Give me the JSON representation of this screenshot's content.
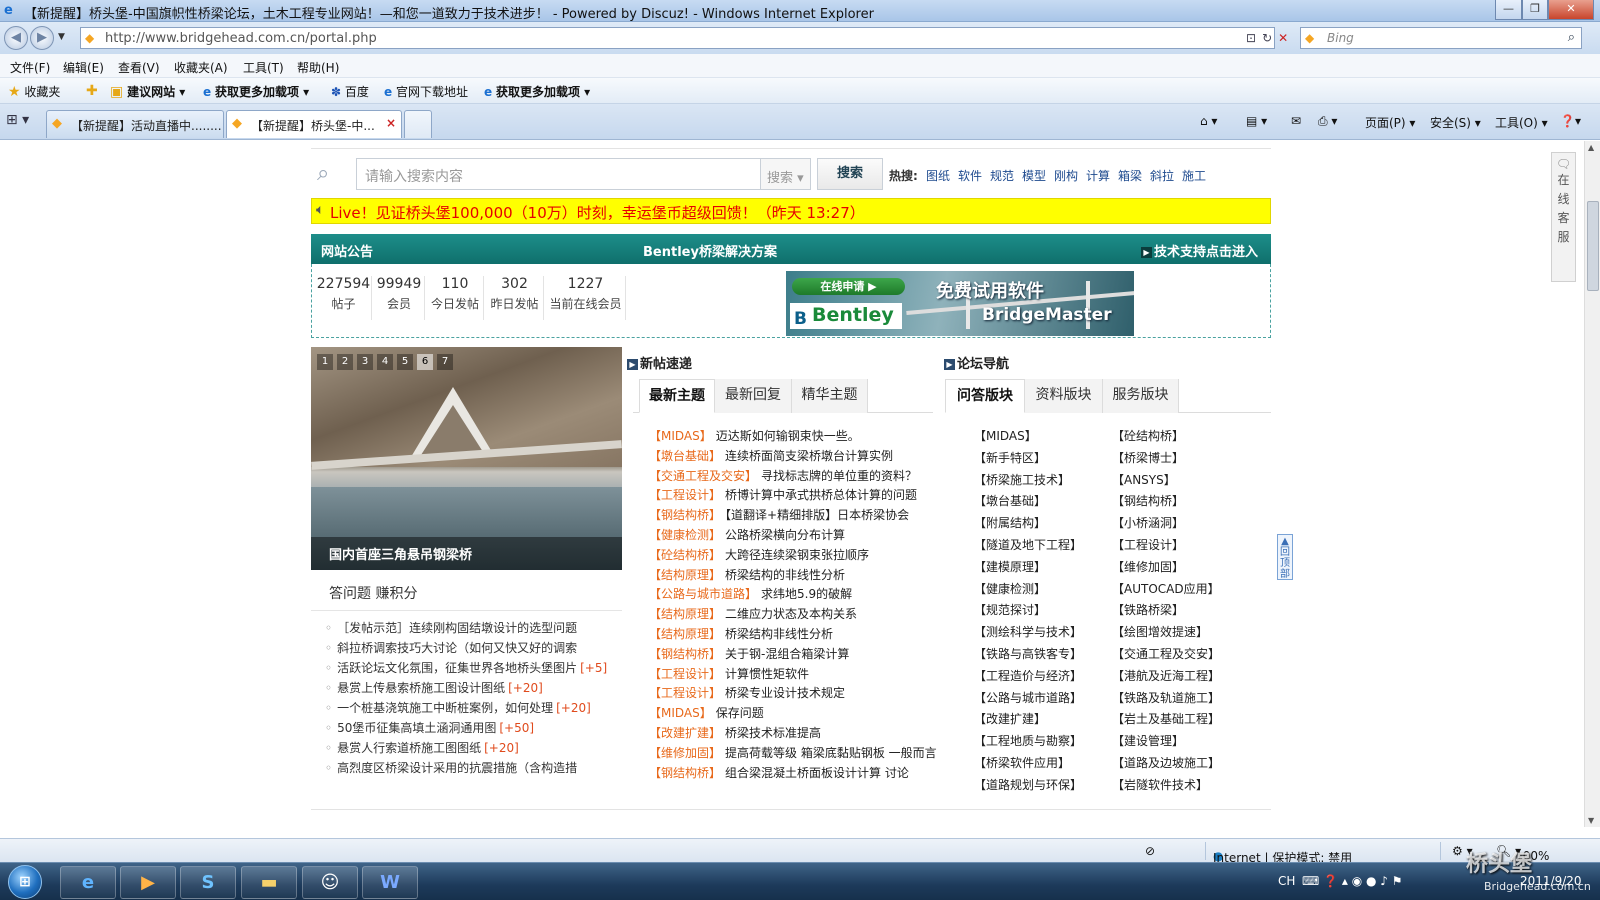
{
  "window": {
    "title": "【新提醒】桥头堡-中国旗帜性桥梁论坛，土木工程专业网站！—和您一道致力于技术进步！ - Powered by Discuz! - Windows Internet Explorer"
  },
  "address": {
    "url": "http://www.bridgehead.com.cn/portal.php",
    "search_placeholder": "Bing"
  },
  "menu": [
    "文件(F)",
    "编辑(E)",
    "查看(V)",
    "收藏夹(A)",
    "工具(T)",
    "帮助(H)"
  ],
  "favorites": {
    "label": "收藏夹",
    "items": [
      "建议网站 ▾",
      "获取更多加载项 ▾",
      "百度",
      "官网下载地址",
      "获取更多加载项 ▾"
    ]
  },
  "tabs": [
    {
      "label": "【新提醒】活动直播中........",
      "active": false
    },
    {
      "label": "【新提醒】桥头堡-中...",
      "active": true
    }
  ],
  "commandbar": [
    "页面(P) ▾",
    "安全(S) ▾",
    "工具(O) ▾"
  ],
  "site": {
    "search_placeholder": "请输入搜索内容",
    "search_scope": "搜索 ▾",
    "search_button": "搜索",
    "hot_label": "热搜:",
    "hot_terms": [
      "图纸",
      "软件",
      "规范",
      "模型",
      "刚构",
      "计算",
      "箱梁",
      "斜拉",
      "施工"
    ],
    "notice": "Live！见证桥头堡100,000（10万）时刻，幸运堡币超级回馈！（昨天 13:27）",
    "announce_left": "网站公告",
    "announce_center": "Bentley桥梁解决方案",
    "announce_right": "技术支持点击进入",
    "stats": [
      {
        "value": "227594",
        "label": "帖子"
      },
      {
        "value": "99949",
        "label": "会员"
      },
      {
        "value": "110",
        "label": "今日发帖"
      },
      {
        "value": "302",
        "label": "昨日发帖"
      },
      {
        "value": "1227",
        "label": "当前在线会员"
      }
    ],
    "banner": {
      "apply": "在线申请 ▶",
      "trial": "免费试用软件",
      "logo": "Bentley",
      "product": "BridgeMaster"
    },
    "slider": {
      "pages": [
        "1",
        "2",
        "3",
        "4",
        "5",
        "6",
        "7"
      ],
      "active_page": "6",
      "caption": "国内首座三角悬吊钢梁桥"
    },
    "qa": {
      "title": "答问题 赚积分",
      "items": [
        {
          "text": "［发帖示范］连续刚构固结墩设计的选型问题",
          "points": ""
        },
        {
          "text": "斜拉桥调索技巧大讨论（如何又快又好的调索",
          "points": ""
        },
        {
          "text": "活跃论坛文化氛围，征集世界各地桥头堡图片",
          "points": "[+5]"
        },
        {
          "text": "悬赏上传悬索桥施工图设计图纸",
          "points": "[+20]"
        },
        {
          "text": "一个桩基浇筑施工中断桩案例，如何处理",
          "points": "[+20]"
        },
        {
          "text": "50堡币征集高填土涵洞通用图",
          "points": "[+50]"
        },
        {
          "text": "悬赏人行索道桥施工图图纸",
          "points": "[+20]"
        },
        {
          "text": "高烈度区桥梁设计采用的抗震措施（含构造措",
          "points": ""
        }
      ]
    },
    "new_posts": {
      "title": "新帖速递",
      "tabs": [
        "最新主题",
        "最新回复",
        "精华主题"
      ],
      "items": [
        {
          "cat": "【MIDAS】",
          "title": "迈达斯如何输钢束快一些。"
        },
        {
          "cat": "【墩台基础】",
          "title": "连续桥面简支梁桥墩台计算实例"
        },
        {
          "cat": "【交通工程及交安】",
          "title": "寻找标志牌的单位重的资料？"
        },
        {
          "cat": "【工程设计】",
          "title": "桥博计算中承式拱桥总体计算的问题"
        },
        {
          "cat": "【钢结构桥】",
          "title": "【道翻译+精细排版】日本桥梁协会"
        },
        {
          "cat": "【健康检测】",
          "title": "公路桥梁横向分布计算"
        },
        {
          "cat": "【砼结构桥】",
          "title": "大跨径连续梁钢束张拉顺序"
        },
        {
          "cat": "【结构原理】",
          "title": "桥梁结构的非线性分析"
        },
        {
          "cat": "【公路与城市道路】",
          "title": "求纬地5.9的破解"
        },
        {
          "cat": "【结构原理】",
          "title": "二维应力状态及本构关系"
        },
        {
          "cat": "【结构原理】",
          "title": "桥梁结构非线性分析"
        },
        {
          "cat": "【钢结构桥】",
          "title": "关于钢-混组合箱梁计算"
        },
        {
          "cat": "【工程设计】",
          "title": "计算惯性矩软件"
        },
        {
          "cat": "【工程设计】",
          "title": "桥梁专业设计技术规定"
        },
        {
          "cat": "【MIDAS】",
          "title": "保存问题"
        },
        {
          "cat": "【改建扩建】",
          "title": "桥梁技术标准提高"
        },
        {
          "cat": "【维修加固】",
          "title": "提高荷载等级 箱梁底黏贴钢板 一般而言"
        },
        {
          "cat": "【钢结构桥】",
          "title": "组合梁混凝土桥面板设计计算 讨论"
        }
      ]
    },
    "forum_nav": {
      "title": "论坛导航",
      "tabs": [
        "问答版块",
        "资料版块",
        "服务版块"
      ],
      "col1": [
        "【MIDAS】",
        "【新手特区】",
        "【桥梁施工技术】",
        "【墩台基础】",
        "【附属结构】",
        "【隧道及地下工程】",
        "【建模原理】",
        "【健康检测】",
        "【规范探讨】",
        "【测绘科学与技术】",
        "【铁路与高铁客专】",
        "【工程造价与经济】",
        "【公路与城市道路】",
        "【改建扩建】",
        "【工程地质与勘察】",
        "【桥梁软件应用】",
        "【道路规划与环保】"
      ],
      "col2": [
        "【砼结构桥】",
        "【桥梁博士】",
        "【ANSYS】",
        "【钢结构桥】",
        "【小桥涵洞】",
        "【工程设计】",
        "【维修加固】",
        "【AUTOCAD应用】",
        "【铁路桥梁】",
        "【绘图增效提速】",
        "【交通工程及交安】",
        "【港航及近海工程】",
        "【铁路及轨道施工】",
        "【岩土及基础工程】",
        "【建设管理】",
        "【道路及边坡施工】",
        "【岩隧软件技术】"
      ]
    },
    "side_service": [
      "在",
      "线",
      "客",
      "服"
    ],
    "to_top": "回顶部"
  },
  "status": {
    "zone": "Internet | 保护模式: 禁用",
    "zoom": "100%"
  },
  "taskbar": {
    "tray_lang": "CH",
    "clock": "2011/9/20"
  },
  "watermark": {
    "text": "桥头堡",
    "url": "Bridgehead.com.cn"
  },
  "colors": {
    "accent_teal": "#1d8e8a",
    "notice_yellow": "#ffff00",
    "notice_red": "#e60000",
    "category_orange": "#e8691b"
  }
}
